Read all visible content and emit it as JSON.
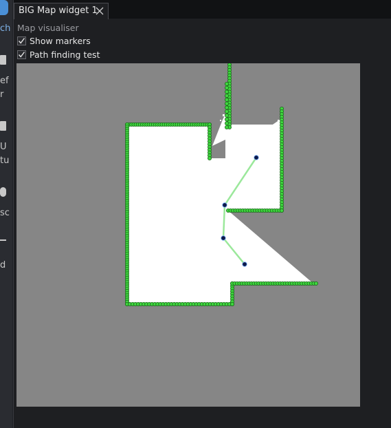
{
  "background_fragments": [
    "ch",
    "ef",
    "r",
    "U",
    "tu",
    "sc",
    "d"
  ],
  "window": {
    "tab": {
      "title": "BIG Map widget 1",
      "close_icon": "close-icon"
    }
  },
  "panel": {
    "title": "Map visualiser",
    "options": [
      {
        "label": "Show markers",
        "checked": true
      },
      {
        "label": "Path finding test",
        "checked": true
      }
    ]
  },
  "map": {
    "colors": {
      "unknown": "#868686",
      "free": "#ffffff",
      "marker_fill": "#3fd63f",
      "marker_stroke": "#1a6a1a",
      "path": "#9be89b",
      "waypoint": "#0d1a4a"
    }
  }
}
